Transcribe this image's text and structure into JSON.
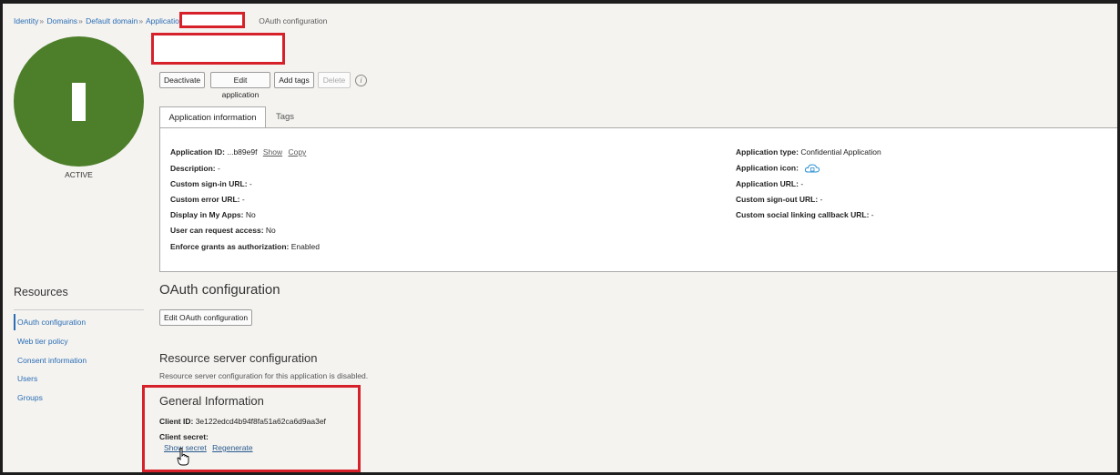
{
  "breadcrumb": {
    "items": [
      "Identity",
      "Domains",
      "Default domain",
      "Applications"
    ],
    "current": "OAuth configuration"
  },
  "app": {
    "avatar_letter": "I",
    "status": "ACTIVE",
    "avatar_color": "#4d7f2a"
  },
  "actions": {
    "deactivate": "Deactivate",
    "edit_application": "Edit application",
    "add_tags": "Add tags",
    "delete": "Delete",
    "info_icon": "i"
  },
  "tabs": [
    {
      "label": "Application information",
      "active": true
    },
    {
      "label": "Tags",
      "active": false
    }
  ],
  "details": {
    "left": [
      {
        "key": "Application ID:",
        "value": "...b89e9f",
        "links": [
          "Show",
          "Copy"
        ]
      },
      {
        "key": "Description:",
        "value": "-"
      },
      {
        "key": "Custom sign-in URL:",
        "value": "-"
      },
      {
        "key": "Custom error URL:",
        "value": "-"
      },
      {
        "key": "Display in My Apps:",
        "value": "No"
      },
      {
        "key": "User can request access:",
        "value": "No"
      },
      {
        "key": "Enforce grants as authorization:",
        "value": "Enabled"
      }
    ],
    "right": [
      {
        "key": "Application type:",
        "value": "Confidential Application"
      },
      {
        "key": "Application icon:",
        "value": ""
      },
      {
        "key": "Application URL:",
        "value": "-"
      },
      {
        "key": "Custom sign-out URL:",
        "value": "-"
      },
      {
        "key": "Custom social linking callback URL:",
        "value": "-"
      }
    ]
  },
  "resources": {
    "title": "Resources",
    "items": [
      "OAuth configuration",
      "Web tier policy",
      "Consent information",
      "Users",
      "Groups"
    ]
  },
  "oauth": {
    "title": "OAuth configuration",
    "edit_button": "Edit OAuth configuration"
  },
  "resource_server": {
    "title": "Resource server configuration",
    "subtitle": "Resource server configuration for this application is disabled."
  },
  "general": {
    "title": "General Information",
    "client_id_label": "Client ID:",
    "client_id_value": "3e122edcd4b94f8fa51a62ca6d9aa3ef",
    "client_secret_label": "Client secret:",
    "show_secret": "Show secret",
    "regenerate": "Regenerate"
  },
  "colors": {
    "accent": "#2a6db5",
    "highlight": "#d7212a"
  }
}
